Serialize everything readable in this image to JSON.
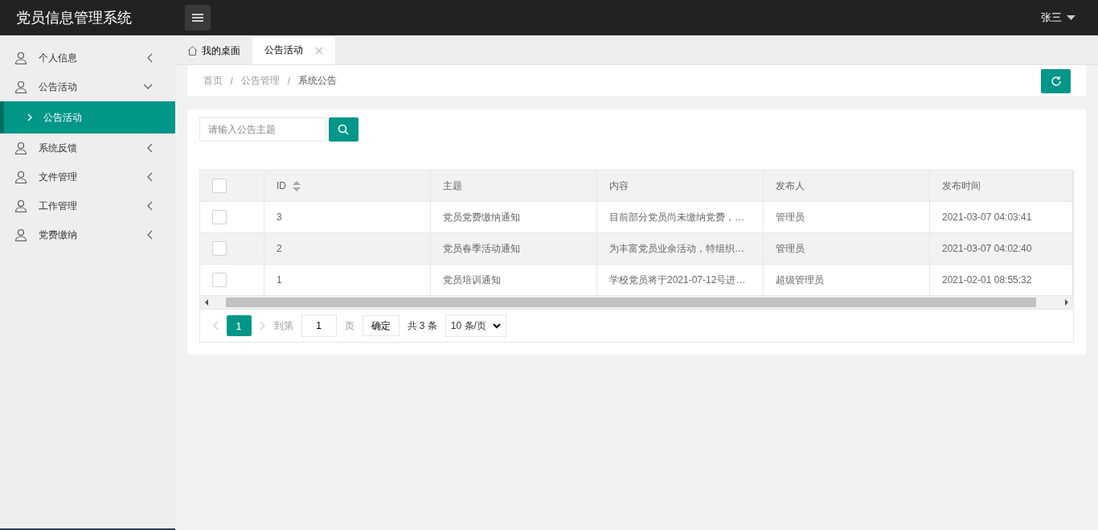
{
  "header": {
    "title": "党员信息管理系统",
    "user": "张三"
  },
  "sidebar": {
    "items": [
      {
        "label": "个人信息",
        "expanded": false
      },
      {
        "label": "公告活动",
        "expanded": true,
        "children": [
          {
            "label": "公告活动",
            "selected": true
          }
        ]
      },
      {
        "label": "系统反馈",
        "expanded": false
      },
      {
        "label": "文件管理",
        "expanded": false
      },
      {
        "label": "工作管理",
        "expanded": false
      },
      {
        "label": "党费缴纳",
        "expanded": false
      }
    ]
  },
  "tabs": [
    {
      "label": "我的桌面",
      "kind": "home",
      "selected": false
    },
    {
      "label": "公告活动",
      "kind": "closable",
      "selected": true
    }
  ],
  "breadcrumb": {
    "separator": "/",
    "items": [
      "首页",
      "公告管理",
      "系统公告"
    ]
  },
  "search": {
    "placeholder": "请输入公告主题"
  },
  "table": {
    "select_all_checked": false,
    "columns": [
      "ID",
      "主题",
      "内容",
      "发布人",
      "发布时间"
    ],
    "rows": [
      {
        "checked": false,
        "highlighted": false,
        "cells": [
          "3",
          "党员党费缴纳通知",
          "目前部分党员尚未缴纳党费，…",
          "管理员",
          "2021-03-07 04:03:41"
        ]
      },
      {
        "checked": false,
        "highlighted": true,
        "cells": [
          "2",
          "党员春季活动通知",
          "为丰富党员业余活动，特组织…",
          "管理员",
          "2021-03-07 04:02:40"
        ]
      },
      {
        "checked": false,
        "highlighted": false,
        "cells": [
          "1",
          "党员培训通知",
          "学校党员将于2021-07-12号进…",
          "超级管理员",
          "2021-02-01 08:55:32"
        ]
      }
    ]
  },
  "pagination": {
    "pages": [
      {
        "label": "1",
        "selected": true
      }
    ],
    "goto_label": "到第",
    "goto_value": "1",
    "page_unit": "页",
    "confirm": "确定",
    "total": "共 3 条",
    "page_size": "10 条/页"
  }
}
